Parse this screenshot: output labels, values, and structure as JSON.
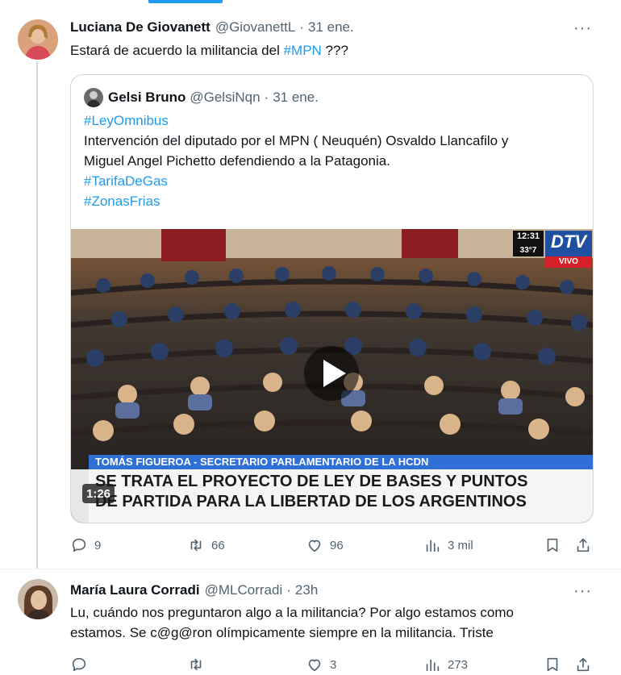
{
  "tweet1": {
    "author_name": "Luciana De Giovanett",
    "handle": "@GiovanettL",
    "separator": "·",
    "date": "31 ene.",
    "more": "···",
    "text_before": "Estará de acuerdo la militancia del ",
    "hashtag": "#MPN",
    "text_after": " ???",
    "quote": {
      "author_name": "Gelsi Bruno",
      "handle": "@GelsiNqn",
      "separator": "·",
      "date": "31 ene.",
      "lines": [
        "#LeyOmnibus",
        "Intervención del diputado por el MPN ( Neuquén) Osvaldo Llancafilo y",
        "Miguel Angel Pichetto defendiendo a la Patagonia.",
        "#TarifaDeGas",
        "#ZonasFrias"
      ],
      "video": {
        "clock": "12:31",
        "temp": "33°7",
        "channel": "DTV",
        "live": "VIVO",
        "name_bar": "TOMÁS FIGUEROA - SECRETARIO PARLAMENTARIO DE LA HCDN",
        "headline_1": "SE TRATA EL PROYECTO DE LEY DE BASES Y PUNTOS",
        "headline_2": "DE PARTIDA PARA LA LIBERTAD DE LOS ARGENTINOS",
        "duration": "1:26"
      }
    },
    "actions": {
      "replies": "9",
      "reposts": "66",
      "likes": "96",
      "views": "3 mil"
    }
  },
  "tweet2": {
    "author_name": "María Laura Corradi",
    "handle": "@MLCorradi",
    "separator": "·",
    "date": "23h",
    "more": "···",
    "text_line1": "Lu, cuándo nos preguntaron algo a la militancia? Por algo estamos como",
    "text_line2": "estamos. Se c@g@ron olímpicamente siempre en la militancia. Triste",
    "actions": {
      "replies": "",
      "reposts": "",
      "likes": "3",
      "views": "273"
    }
  },
  "colors": {
    "accent": "#1d9bf0",
    "muted": "#536471",
    "border": "#cfd9de"
  }
}
